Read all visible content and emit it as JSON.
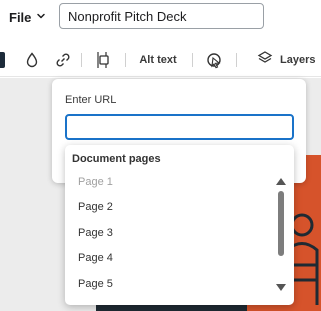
{
  "header": {
    "file_label": "File",
    "document_title": "Nonprofit Pitch Deck"
  },
  "toolbar": {
    "swatch_color": "#1d2b3a",
    "icons": [
      "color-fill-icon",
      "link-icon",
      "position-icon",
      "animate-icon",
      "layers-icon"
    ],
    "alt_text_label": "Alt text",
    "layers_label": "Layers"
  },
  "url_popup": {
    "label": "Enter URL",
    "value": "",
    "accent": "#1a73c9"
  },
  "pages_dropdown": {
    "header": "Document pages",
    "items": [
      {
        "label": "Page 1",
        "disabled": true
      },
      {
        "label": "Page 2",
        "disabled": false
      },
      {
        "label": "Page 3",
        "disabled": false
      },
      {
        "label": "Page 4",
        "disabled": false
      },
      {
        "label": "Page 5",
        "disabled": false
      }
    ]
  },
  "canvas": {
    "page_dark": "#1f2a33",
    "page_accent": "#d6532b"
  }
}
